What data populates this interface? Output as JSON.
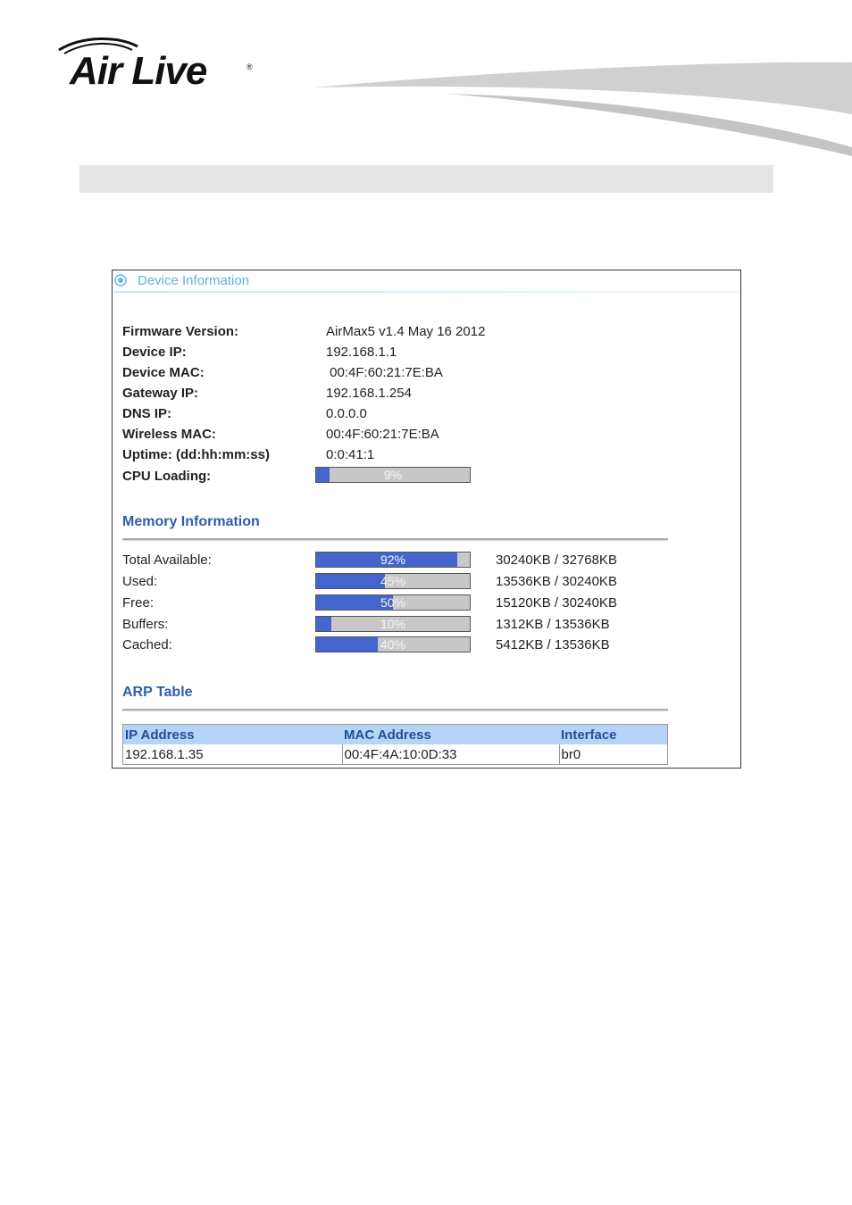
{
  "brand": {
    "logo_text": "Air Live",
    "logo_mark": "®"
  },
  "panel": {
    "title": "Device Information"
  },
  "device_info": [
    {
      "label": "Firmware Version:",
      "value": "AirMax5 v1.4 May 16 2012"
    },
    {
      "label": "Device IP:",
      "value": "192.168.1.1"
    },
    {
      "label": "Device MAC:",
      "value": " 00:4F:60:21:7E:BA"
    },
    {
      "label": "Gateway IP:",
      "value": "192.168.1.254"
    },
    {
      "label": "DNS IP:",
      "value": "0.0.0.0"
    },
    {
      "label": "Wireless MAC:",
      "value": "00:4F:60:21:7E:BA"
    },
    {
      "label": "Uptime: (dd:hh:mm:ss)",
      "value": "0:0:41:1"
    }
  ],
  "cpu": {
    "label": "CPU Loading:",
    "percent_text": "9%",
    "percent": 9
  },
  "memory": {
    "title": "Memory Information",
    "rows": [
      {
        "label": "Total Available:",
        "percent_text": "92%",
        "percent": 92,
        "value": "30240KB / 32768KB"
      },
      {
        "label": "Used:",
        "percent_text": "45%",
        "percent": 45,
        "value": "13536KB / 30240KB"
      },
      {
        "label": "Free:",
        "percent_text": "50%",
        "percent": 50,
        "value": "15120KB / 30240KB"
      },
      {
        "label": "Buffers:",
        "percent_text": "10%",
        "percent": 10,
        "value": "1312KB / 13536KB"
      },
      {
        "label": "Cached:",
        "percent_text": "40%",
        "percent": 40,
        "value": "5412KB / 13536KB"
      }
    ]
  },
  "arp": {
    "title": "ARP Table",
    "headers": [
      "IP Address",
      "MAC Address",
      "Interface"
    ],
    "rows": [
      [
        "192.168.1.35",
        "00:4F:4A:10:0D:33",
        "br0"
      ]
    ]
  },
  "colors": {
    "accent": "#4466cc",
    "header_blue": "#2d5fa8",
    "table_header_bg": "#b7d3f7"
  }
}
